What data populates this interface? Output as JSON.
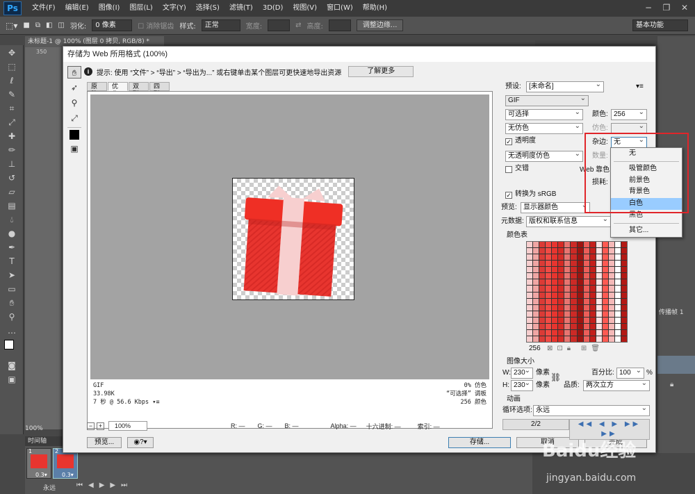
{
  "app": {
    "logo": "Ps",
    "menus": [
      "文件(F)",
      "编辑(E)",
      "图像(I)",
      "图层(L)",
      "文字(Y)",
      "选择(S)",
      "滤镜(T)",
      "3D(D)",
      "视图(V)",
      "窗口(W)",
      "帮助(H)"
    ]
  },
  "options": {
    "feather_label": "羽化:",
    "feather_value": "0 像素",
    "antialias": "消除锯齿",
    "style_label": "样式:",
    "style_value": "正常",
    "width_label": "宽度:",
    "height_label": "高度:",
    "refine_edge": "调整边缘...",
    "workspace": "基本功能"
  },
  "document": {
    "tab": "未标题-1 @ 100% (图层 0 拷贝, RGB/8) *",
    "zoom": "100%",
    "ruler_mark": "350"
  },
  "timeline": {
    "tab": "时间轴",
    "frames": [
      {
        "n": "1",
        "delay": "0.3▾"
      },
      {
        "n": "2",
        "delay": "0.3▾"
      }
    ],
    "loop": "永远"
  },
  "right_panel": {
    "frame_label": "传播帧 1"
  },
  "dialog": {
    "title": "存储为 Web 所用格式 (100%)",
    "tip": "提示: 使用 “文件” > “导出” > “导出为...” 或右键单击某个图层可更快速地导出资源",
    "learn_more": "了解更多",
    "tabs": [
      "原稿",
      "优化",
      "双联",
      "四联"
    ],
    "info_left": [
      "GIF",
      "33.98K",
      "7 秒 @ 56.6 Kbps ▾≡"
    ],
    "info_right": [
      "0% 仿色",
      "“可选择” 调板",
      "256 颜色"
    ],
    "zoom": "100%",
    "readout": {
      "r": "R: —",
      "g": "G: —",
      "b": "B: —",
      "alpha": "Alpha: —",
      "hex": "十六进制: —",
      "index": "索引: —"
    },
    "preview_btn": "预览...",
    "save_btn": "存储...",
    "done_btn": "完成",
    "cancel_btn": "取消"
  },
  "settings": {
    "preset_label": "预设:",
    "preset_value": "[未命名]",
    "format": "GIF",
    "reduction": "可选择",
    "colors_label": "颜色:",
    "colors_value": "256",
    "dither": "无仿色",
    "dither_label": "仿色:",
    "transparency": "透明度",
    "matte_label": "杂边:",
    "matte_value": "无",
    "trans_dither": "无透明度仿色",
    "amount_label": "数量:",
    "interlaced": "交错",
    "web_snap_label": "Web 靠色:",
    "lossy_label": "损耗:",
    "convert_srgb": "转换为 sRGB",
    "preview_label": "预览:",
    "preview_value": "显示器颜色",
    "metadata_label": "元数据:",
    "metadata_value": "版权和联系信息",
    "color_table": "颜色表",
    "color_count": "256",
    "image_size": "图像大小",
    "w_label": "W:",
    "w_value": "230",
    "h_label": "H:",
    "h_value": "230",
    "unit": "像素",
    "percent_label": "百分比:",
    "percent_value": "100",
    "percent_unit": "%",
    "quality_label": "品质:",
    "quality_value": "两次立方",
    "animation": "动画",
    "loop_label": "循环选项:",
    "loop_value": "永远",
    "frame_counter": "2/2"
  },
  "matte_menu": {
    "items": [
      "无",
      "吸管颜色",
      "前景色",
      "背景色",
      "白色",
      "黑色",
      "其它..."
    ],
    "highlighted": "白色"
  },
  "watermark": {
    "brand": "Baidu经验",
    "url": "jingyan.baidu.com"
  },
  "colors": {
    "accent_red": "#e0252a",
    "highlight": "#99ccff",
    "gift_red": "#e8352f",
    "ribbon_pink": "#f7cfcf"
  }
}
